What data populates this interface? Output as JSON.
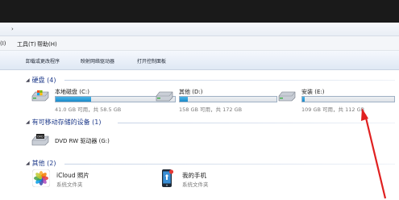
{
  "address_bar": {
    "chevron": "›"
  },
  "menu": {
    "items": [
      "(I)",
      "工具(T)",
      "帮助(H)"
    ]
  },
  "commands": [
    "卸载或更改程序",
    "映射网络驱动器",
    "打开控制面板"
  ],
  "sections": {
    "hard_disks": {
      "title": "硬盘 (4)",
      "drives": [
        {
          "name": "本地磁盘 (C:)",
          "usage": "41.0 GB 可用，共 58.5 GB",
          "used_fraction": 0.3,
          "icon": "windows-drive-icon"
        },
        {
          "name": "其他 (D:)",
          "usage": "158 GB 可用，共 172 GB",
          "used_fraction": 0.08,
          "icon": "hard-drive-icon"
        },
        {
          "name": "安装 (E:)",
          "usage": "109 GB 可用，共 112 GB",
          "used_fraction": 0.03,
          "icon": "hard-drive-icon"
        }
      ]
    },
    "removable": {
      "title": "有可移动存储的设备 (1)",
      "devices": [
        {
          "name": "DVD RW 驱动器 (G:)",
          "icon": "dvd-drive-icon"
        }
      ]
    },
    "other": {
      "title": "其他 (2)",
      "items": [
        {
          "title": "iCloud 照片",
          "subtitle": "系统文件夹",
          "icon": "photos-icon"
        },
        {
          "title": "我的手机",
          "subtitle": "系统文件夹",
          "icon": "phone-icon"
        }
      ]
    }
  },
  "colors": {
    "usage_bar": "#1b8bc9",
    "section_header": "#1e3a8a",
    "arrow": "#e02020"
  }
}
